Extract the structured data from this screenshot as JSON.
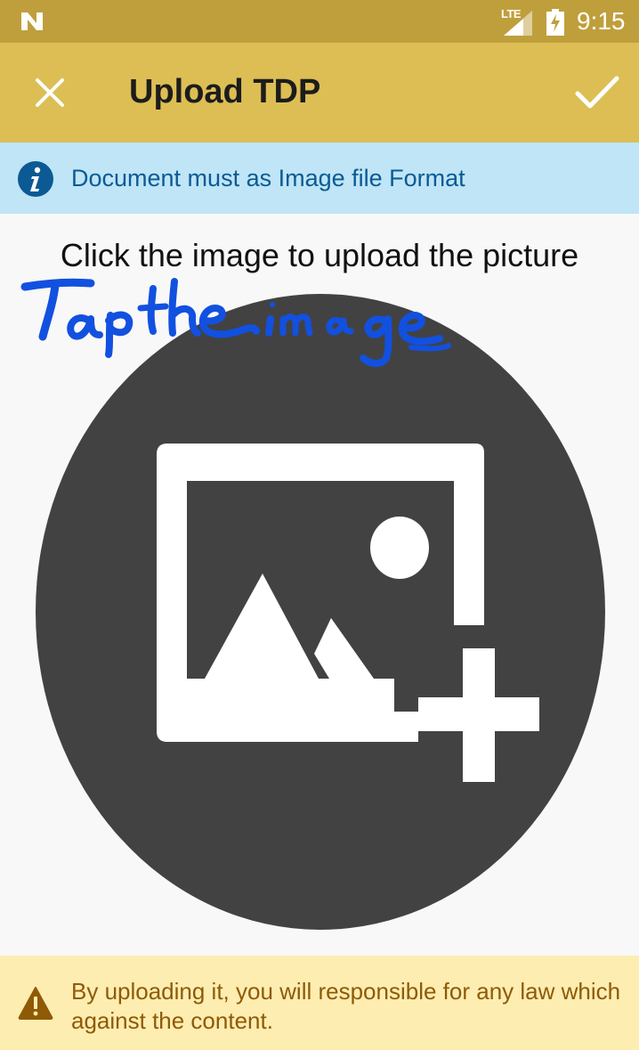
{
  "status_bar": {
    "network_label": "LTE",
    "time": "9:15"
  },
  "toolbar": {
    "title": "Upload TDP",
    "close_icon": "close-icon",
    "confirm_icon": "check-icon"
  },
  "info_banner": {
    "icon": "info-icon",
    "text": "Document must as Image file Format"
  },
  "main": {
    "instruction": "Click the image to upload the picture",
    "annotation_handwritten": "Tap the image",
    "upload_icon": "add-photo-icon"
  },
  "warning_banner": {
    "icon": "warning-icon",
    "text": "By uploading it, you will responsible for any law which against the content."
  },
  "colors": {
    "status_bar": "#bf9f3c",
    "toolbar": "#dcbe54",
    "info_background": "#bfe5f6",
    "info_text": "#0b5a94",
    "upload_circle": "#424242",
    "warning_background": "#fdedb1",
    "warning_text": "#8f5a06",
    "annotation_ink": "#1250e0"
  }
}
